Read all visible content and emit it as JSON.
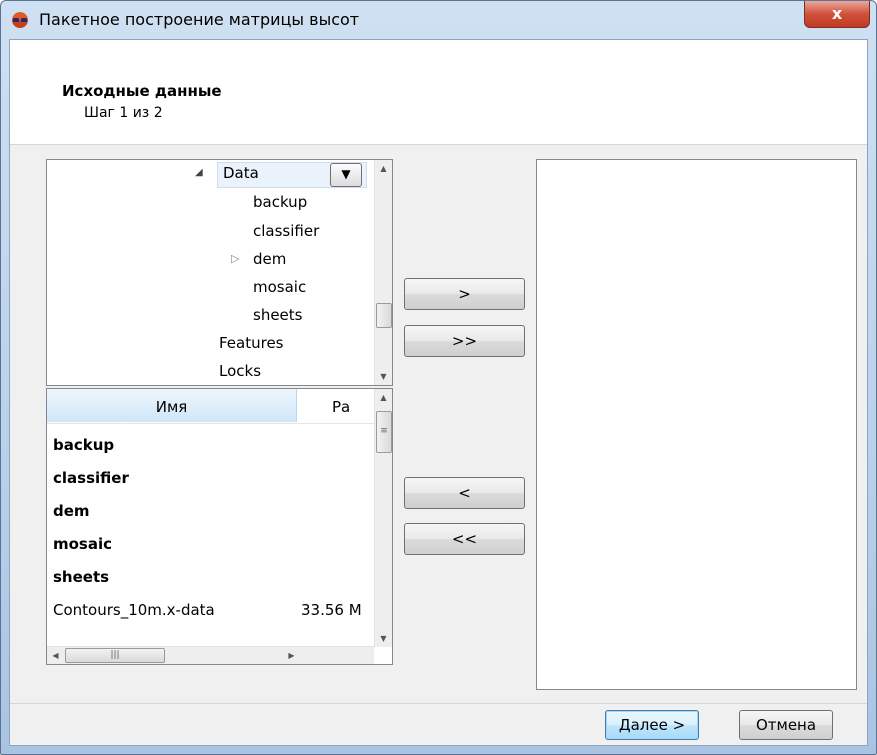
{
  "window": {
    "title": "Пакетное построение матрицы высот",
    "close_label": "x"
  },
  "header": {
    "title": "Исходные данные",
    "step": "Шаг 1 из 2"
  },
  "tree": {
    "selected": "Data",
    "dropdown_glyph": "▼",
    "expand_glyph": "◢",
    "collapsed_glyph": "▷",
    "children": [
      "backup",
      "classifier",
      "dem",
      "mosaic",
      "sheets"
    ],
    "siblings": [
      "Features",
      "Locks"
    ]
  },
  "file_list": {
    "columns": [
      "Имя",
      "Ра"
    ],
    "rows": [
      {
        "name": "backup",
        "size": ""
      },
      {
        "name": "classifier",
        "size": ""
      },
      {
        "name": "dem",
        "size": ""
      },
      {
        "name": "mosaic",
        "size": ""
      },
      {
        "name": "sheets",
        "size": ""
      },
      {
        "name": "Contours_10m.x-data",
        "size": "33.56 M"
      }
    ]
  },
  "transfer_buttons": {
    "add": ">",
    "add_all": ">>",
    "remove": "<",
    "remove_all": "<<"
  },
  "footer": {
    "next": "Далее >",
    "cancel": "Отмена"
  }
}
